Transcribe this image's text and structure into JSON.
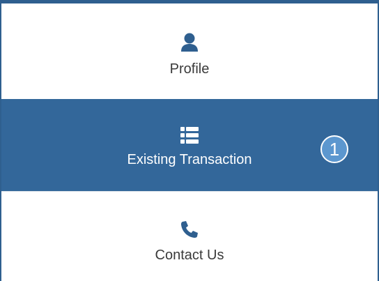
{
  "menu": {
    "items": [
      {
        "label": "Profile",
        "icon": "user-icon",
        "active": false
      },
      {
        "label": "Existing Transaction",
        "icon": "list-icon",
        "active": true,
        "badge": "1"
      },
      {
        "label": "Contact Us",
        "icon": "phone-icon",
        "active": false
      }
    ]
  },
  "colors": {
    "accent": "#33679a",
    "border": "#2f5f8f",
    "badge": "#5c97cf",
    "icon": "#2f5f8f"
  }
}
